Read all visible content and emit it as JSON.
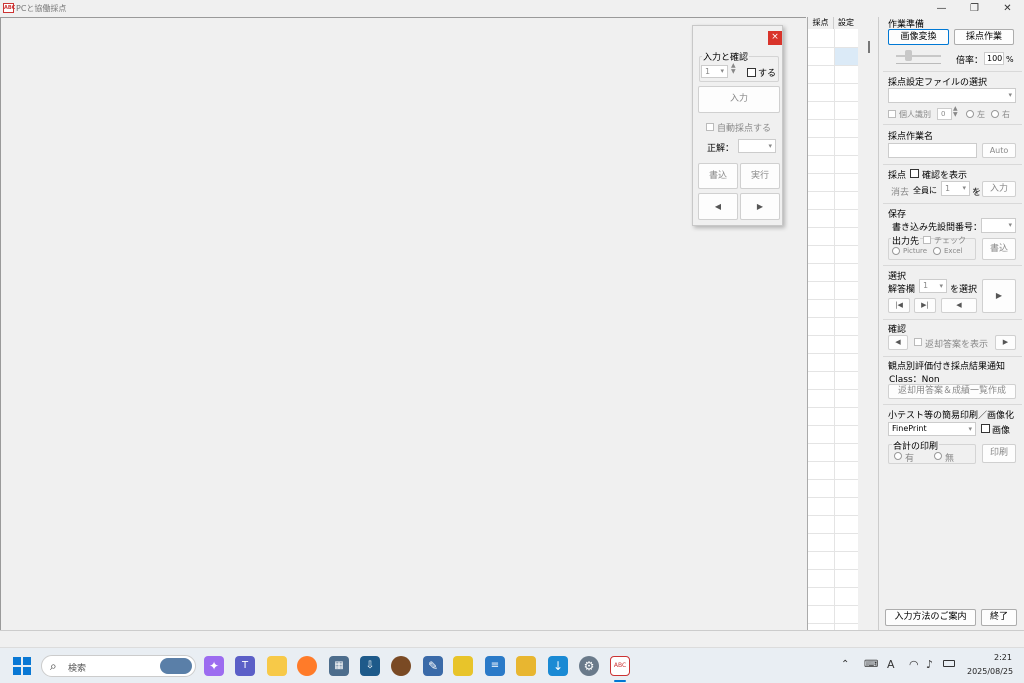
{
  "window": {
    "title": "PCと協働採点",
    "icon_label": "ABC"
  },
  "window_controls": {
    "minimize": "—",
    "restore": "❐",
    "close": "✕"
  },
  "dialog": {
    "close_label": "×",
    "group_title": "入力と確認",
    "number_value": "1",
    "confirm_check_label": "する",
    "input_button": "入力",
    "auto_grade_label": "自動採点する",
    "answer_label": "正解：",
    "write_button": "書込",
    "run_button": "実行",
    "prev_button": "◀",
    "next_button": "▶"
  },
  "grid": {
    "col1": "採点",
    "col2": "設定"
  },
  "prep": {
    "title": "作業準備",
    "convert_button": "画像変換",
    "grading_button": "採点作業",
    "zoom_label": "倍率：",
    "zoom_value": "100",
    "zoom_unit": "%"
  },
  "settings_file": {
    "title": "採点設定ファイルの選択",
    "personal_id_label": "個人識別",
    "personal_id_value": "0",
    "left_label": "左",
    "right_label": "右"
  },
  "task_name": {
    "title": "採点作業名",
    "auto_button": "Auto"
  },
  "grading": {
    "title": "採点",
    "show_confirm_label": "確認を表示",
    "erase_label": "消去",
    "all_label": "全員に",
    "value": "1",
    "wo_label": "を",
    "input_button": "入力"
  },
  "save": {
    "title": "保存",
    "dest_question_label": "書き込み先設問番号：",
    "output_label": "出力先",
    "check_label": "チェック",
    "picture_label": "Picture",
    "excel_label": "Excel",
    "write_button": "書込"
  },
  "select": {
    "title": "選択",
    "answer_col_label": "解答欄",
    "answer_col_value": "1",
    "select_label": "を選択",
    "first_button": "|◀",
    "last_button": "▶|",
    "prev_button": "◀",
    "next_button": "▶"
  },
  "confirm": {
    "title": "確認",
    "prev_button": "◀",
    "return_label": "返却答案を表示",
    "next_button": "▶"
  },
  "notify": {
    "title": "観点別評価付き採点結果通知",
    "class_label": "Class：Non",
    "create_button": "返却用答案＆成績一覧作成"
  },
  "print": {
    "title": "小テスト等の簡易印刷／画像化",
    "printer_value": "FinePrint",
    "image_label": "画像",
    "total_label": "合計の印刷",
    "yes_label": "有",
    "no_label": "無",
    "print_button": "印刷"
  },
  "footer": {
    "guide_button": "入力方法のご案内",
    "exit_button": "終了"
  },
  "taskbar": {
    "search_placeholder": "検索",
    "time": "2:21",
    "date": "2025/08/25",
    "ime_label": "A"
  }
}
